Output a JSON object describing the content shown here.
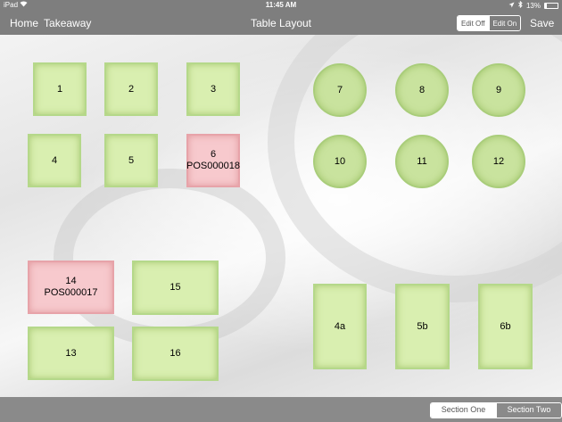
{
  "status_bar": {
    "carrier": "iPad",
    "time": "11:45 AM",
    "battery": "13%",
    "battery_level": 0.13,
    "wifi_icon": "wifi-icon",
    "location_icon": "location-arrow-icon",
    "bluetooth_icon": "bluetooth-icon"
  },
  "nav": {
    "home": "Home",
    "takeaway": "Takeaway",
    "title": "Table Layout",
    "edit_off": "Edit Off",
    "edit_on": "Edit On",
    "save": "Save"
  },
  "tables": [
    {
      "id": "t1",
      "label": "1",
      "sub": "",
      "shape": "square",
      "status": "free"
    },
    {
      "id": "t2",
      "label": "2",
      "sub": "",
      "shape": "square",
      "status": "free"
    },
    {
      "id": "t3",
      "label": "3",
      "sub": "",
      "shape": "square",
      "status": "free"
    },
    {
      "id": "t4",
      "label": "4",
      "sub": "",
      "shape": "square",
      "status": "free"
    },
    {
      "id": "t5",
      "label": "5",
      "sub": "",
      "shape": "square",
      "status": "free"
    },
    {
      "id": "t6",
      "label": "6",
      "sub": "POS000018",
      "shape": "square",
      "status": "occupied"
    },
    {
      "id": "t7",
      "label": "7",
      "sub": "",
      "shape": "round",
      "status": "free"
    },
    {
      "id": "t8",
      "label": "8",
      "sub": "",
      "shape": "round",
      "status": "free"
    },
    {
      "id": "t9",
      "label": "9",
      "sub": "",
      "shape": "round",
      "status": "free"
    },
    {
      "id": "t10",
      "label": "10",
      "sub": "",
      "shape": "round",
      "status": "free"
    },
    {
      "id": "t11",
      "label": "11",
      "sub": "",
      "shape": "round",
      "status": "free"
    },
    {
      "id": "t12",
      "label": "12",
      "sub": "",
      "shape": "round",
      "status": "free"
    },
    {
      "id": "t14",
      "label": "14",
      "sub": "POS000017",
      "shape": "rect",
      "status": "occupied"
    },
    {
      "id": "t15",
      "label": "15",
      "sub": "",
      "shape": "rect",
      "status": "free"
    },
    {
      "id": "t13",
      "label": "13",
      "sub": "",
      "shape": "rect",
      "status": "free"
    },
    {
      "id": "t16",
      "label": "16",
      "sub": "",
      "shape": "rect",
      "status": "free"
    },
    {
      "id": "t4a",
      "label": "4a",
      "sub": "",
      "shape": "rect",
      "status": "free"
    },
    {
      "id": "t5b",
      "label": "5b",
      "sub": "",
      "shape": "rect",
      "status": "free"
    },
    {
      "id": "t6b",
      "label": "6b",
      "sub": "",
      "shape": "rect",
      "status": "free"
    }
  ],
  "sections": {
    "one": "Section One",
    "two": "Section Two"
  },
  "colors": {
    "free": "#d9efb0",
    "occupied": "#f7c9cd",
    "bar": "#7e7e7e"
  }
}
